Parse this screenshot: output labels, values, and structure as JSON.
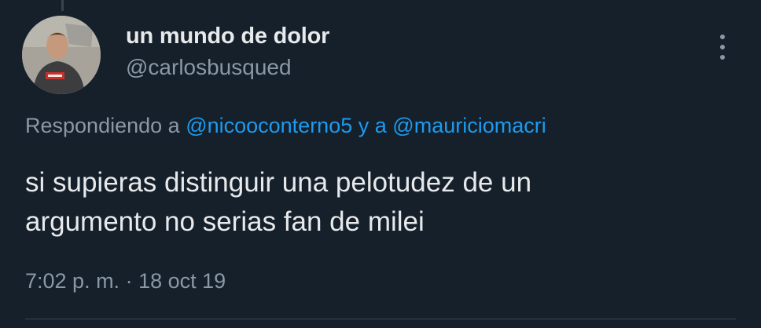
{
  "author": {
    "display_name": "un mundo de dolor",
    "handle": "@carlosbusqued",
    "avatar_icon": "profile-photo"
  },
  "more_icon": "ellipsis-vertical-icon",
  "reply": {
    "prefix": "Respondiendo a",
    "mention_1": "@nicooconterno5",
    "conjunction": "y a",
    "mention_2": "@mauriciomacri"
  },
  "tweet": {
    "text_line_1": "si supieras distinguir una pelotudez de un",
    "text_line_2": "argumento no serias fan de milei"
  },
  "meta": {
    "time": "7:02 p. m.",
    "separator": "·",
    "date": "18 oct 19"
  },
  "colors": {
    "background": "#15202b",
    "text_primary": "#e7e9ea",
    "text_secondary": "#8b98a5",
    "link": "#1d9bf0"
  }
}
